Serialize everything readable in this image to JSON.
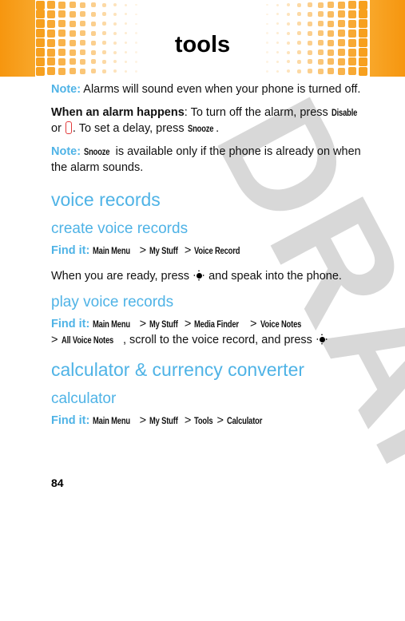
{
  "header": {
    "title": "tools",
    "accent_color": "#f6960f"
  },
  "watermark": "DRAFT",
  "content": {
    "note1": {
      "label": "Note:",
      "text": " Alarms will sound even when your phone is turned off."
    },
    "alarm": {
      "lead": "When an alarm happens",
      "t1": ": To turn off the alarm, press ",
      "key_disable": "Disable",
      "t2": " or ",
      "end_key_icon": "end-key-icon",
      "t3": ". To set a delay, press ",
      "key_snooze": "Snooze",
      "t4": "."
    },
    "note2": {
      "label": "Note:",
      "key_snooze": "Snooze",
      "text": " is available only if the phone is already on when the alarm sounds."
    },
    "voice_records": {
      "heading": "voice records",
      "create": {
        "heading": "create voice records",
        "find_label": "Find it:",
        "path": [
          "Main Menu",
          "My Stuff",
          "Voice Record"
        ],
        "text_before": "When you are ready, press ",
        "nav_icon": "nav-key-icon",
        "text_after": " and speak into the phone."
      },
      "play": {
        "heading": "play voice records",
        "find_label": "Find it:",
        "path": [
          "Main Menu",
          "My Stuff",
          "Media Finder",
          "Voice Notes",
          "All Voice Notes"
        ],
        "text": ", scroll to the voice record, and press "
      }
    },
    "calculator_section": {
      "heading": "calculator & currency converter",
      "calculator": {
        "heading": "calculator",
        "find_label": "Find it:",
        "path": [
          "Main Menu",
          "My Stuff",
          "Tools",
          "Calculator"
        ]
      }
    },
    "separator": ">"
  },
  "page_number": "84"
}
